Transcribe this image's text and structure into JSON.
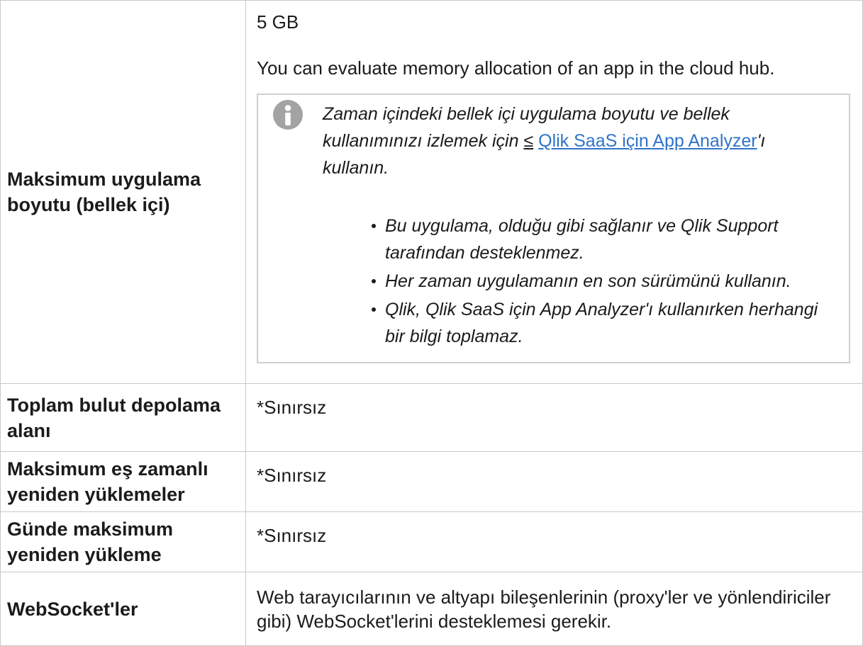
{
  "colors": {
    "text": "#1b1b1b",
    "table_border": "#c9c9c9",
    "note_border": "#cfcfcf",
    "note_icon": "#a3a3a3",
    "link": "#2f73c9"
  },
  "table": {
    "rows": [
      {
        "label": "Maksimum uygulama boyutu (bellek içi)",
        "value": "5 GB",
        "description": "You can evaluate memory allocation of an app in the cloud hub.",
        "note": {
          "icon": "info-icon",
          "text": "Zaman içindeki bellek içi uygulama boyutu ve bellek kullanımınızı izlemek için",
          "link_glyph": "≤",
          "link_text": "Qlik SaaS için App Analyzer",
          "text_after_link": "'ı kullanın.",
          "bullets": [
            "Bu uygulama, olduğu gibi sağlanır ve Qlik Support tarafından desteklenmez.",
            "Her zaman uygulamanın en son sürümünü kullanın.",
            "Qlik, Qlik SaaS için App Analyzer'ı kullanırken herhangi bir bilgi toplamaz."
          ]
        }
      },
      {
        "label": "Toplam bulut depolama alanı",
        "value": "*Sınırsız"
      },
      {
        "label": "Maksimum eş zamanlı yeniden yüklemeler",
        "value": "*Sınırsız"
      },
      {
        "label": "Günde maksimum yeniden yükleme",
        "value": "*Sınırsız"
      },
      {
        "label": "WebSocket'ler",
        "value": "Web tarayıcılarının ve altyapı bileşenlerinin (proxy'ler ve yönlendiriciler gibi) WebSocket'lerini desteklemesi gerekir."
      }
    ]
  }
}
